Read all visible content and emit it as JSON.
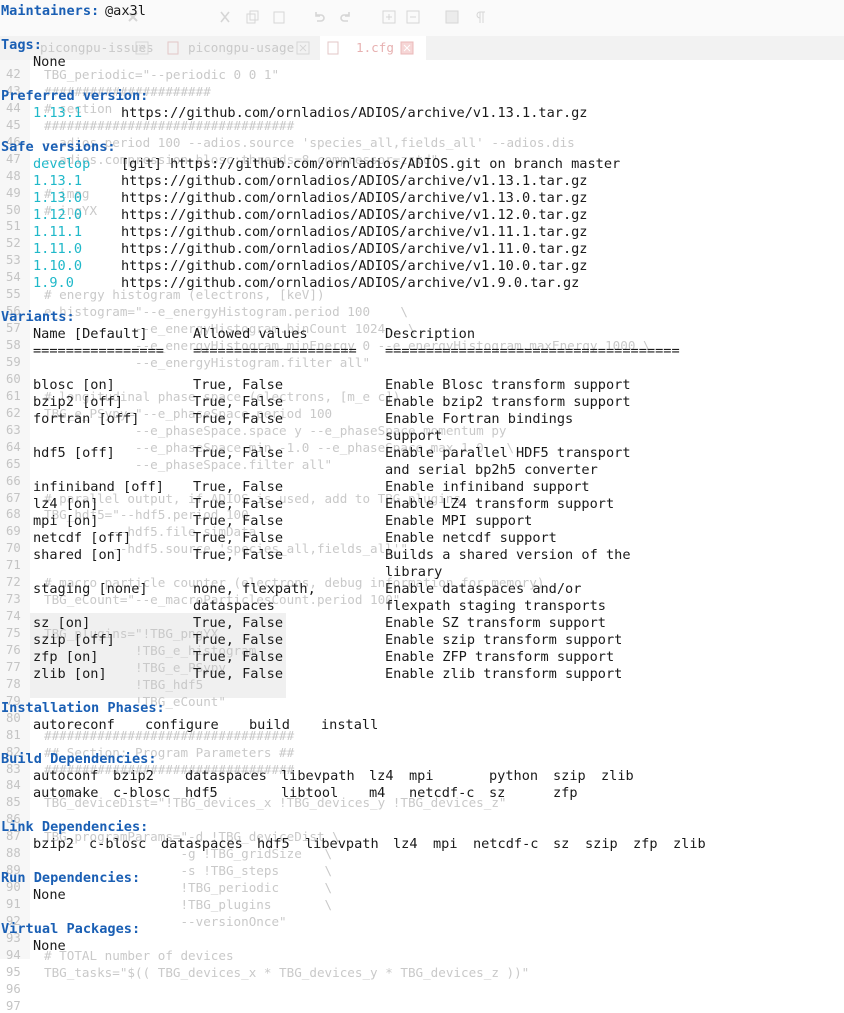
{
  "background_editor": {
    "tabs": [
      {
        "label": "picongpu-issues"
      },
      {
        "label": "picongpu-usage"
      },
      {
        "label": "1.cfg"
      }
    ],
    "gutter_numbers": [
      "42",
      "43",
      "44",
      "45",
      "46",
      "47",
      "48",
      "49",
      "50",
      "51",
      "52",
      "53",
      "54",
      "55",
      "56",
      "57",
      "58",
      "59",
      "60",
      "61",
      "62",
      "63",
      "64",
      "65",
      "66",
      "67",
      "68",
      "69",
      "70",
      "71",
      "72",
      "73",
      "74",
      "75",
      "76",
      "77",
      "78",
      "79",
      "80",
      "81",
      "82",
      "83",
      "84",
      "85",
      "86",
      "87",
      "88",
      "89",
      "90",
      "91",
      "92",
      "93",
      "94",
      "95",
      "96",
      "97"
    ],
    "lines": [
      "TBG_periodic=\"--periodic 0 0 1\"",
      "######################",
      "# section",
      "#################################",
      "--adios.period 100 --adios.source 'species_all,fields_all' --adios.dis",
      "--adios.compression blosc:threads=8,compressor=zstd\"",
      "",
      "# imag",
      "# ingYX",
      "",
      "",
      "",
      "",
      "# energy histogram (electrons, [keV])",
      "e_histogram=\"--e_energyHistogram.period 100    \\",
      "            --e_energyHistogram.binCount 1024   \\",
      "            --e_energyHistogram.minEnergy 0 --e_energyHistogram.maxEnergy 1000 \\",
      "            --e_energyHistogram.filter all\"",
      "",
      "# longitudinal phase space (electrons, [m_e c])",
      "TBG_e_PSypy=\"--e_phaseSpace.period 100",
      "            --e_phaseSpace.space y --e_phaseSpace.momentum py",
      "            --e_phaseSpace.min -1.0 --e_phaseSpace.max 1.0   \\",
      "            --e_phaseSpace.filter all\"",
      "",
      "# parallel output, if ADIOS is used, add to TBG_plugins",
      "TBG_hdf5=\"--hdf5.period 100",
      "         --hdf5.file simData",
      "         --hdf5.source 'species_all,fields_all'\"",
      "",
      "# macro particle counter (electrons, debug information for memory)",
      "TBG_eCount=\"--e_macroParticlesCount.period 100\"",
      "",
      "TBG_plugins=\"!TBG_pngYX",
      "            !TBG_e_histogram",
      "            !TBG_e_PSypy",
      "            !TBG_hdf5",
      "            !TBG_eCount\"",
      "",
      "#################################",
      "## Section: Program Parameters ##",
      "#################################",
      "",
      "TBG_deviceDist=\"!TBG_devices_x !TBG_devices_y !TBG_devices_z\"",
      "",
      "TBG_programParams=\"-d !TBG_deviceDist \\",
      "                  -g !TBG_gridSize   \\",
      "                  -s !TBG_steps      \\",
      "                  !TBG_periodic      \\",
      "                  !TBG_plugins       \\",
      "                  --versionOnce\"",
      "",
      "# TOTAL number of devices",
      "TBG_tasks=\"$(( TBG_devices_x * TBG_devices_y * TBG_devices_z ))\"",
      "",
      ""
    ]
  },
  "info": {
    "maintainers": {
      "heading": "Maintainers:",
      "value": "@ax3l"
    },
    "tags": {
      "heading": "Tags:",
      "value": "None"
    },
    "preferred_version": {
      "heading": "Preferred version:",
      "version": "1.13.1",
      "url": "https://github.com/ornladios/ADIOS/archive/v1.13.1.tar.gz"
    },
    "safe_versions": {
      "heading": "Safe versions:",
      "items": [
        {
          "version": "develop",
          "source": "[git] https://github.com/ornladios/ADIOS.git on branch master"
        },
        {
          "version": "1.13.1",
          "source": "https://github.com/ornladios/ADIOS/archive/v1.13.1.tar.gz"
        },
        {
          "version": "1.13.0",
          "source": "https://github.com/ornladios/ADIOS/archive/v1.13.0.tar.gz"
        },
        {
          "version": "1.12.0",
          "source": "https://github.com/ornladios/ADIOS/archive/v1.12.0.tar.gz"
        },
        {
          "version": "1.11.1",
          "source": "https://github.com/ornladios/ADIOS/archive/v1.11.1.tar.gz"
        },
        {
          "version": "1.11.0",
          "source": "https://github.com/ornladios/ADIOS/archive/v1.11.0.tar.gz"
        },
        {
          "version": "1.10.0",
          "source": "https://github.com/ornladios/ADIOS/archive/v1.10.0.tar.gz"
        },
        {
          "version": "1.9.0",
          "source": "https://github.com/ornladios/ADIOS/archive/v1.9.0.tar.gz"
        }
      ]
    },
    "variants": {
      "heading": "Variants:",
      "columns": {
        "name": "Name [Default]",
        "values": "Allowed values",
        "description": "Description"
      },
      "rules": {
        "name": "================",
        "values": "====================",
        "description": "===================================="
      },
      "rows": [
        {
          "name": "blosc [on]",
          "values": [
            "True, False"
          ],
          "description": [
            "Enable Blosc transform support"
          ]
        },
        {
          "name": "bzip2 [off]",
          "values": [
            "True, False"
          ],
          "description": [
            "Enable bzip2 transform support"
          ]
        },
        {
          "name": "fortran [off]",
          "values": [
            "True, False"
          ],
          "description": [
            "Enable Fortran bindings",
            "support"
          ]
        },
        {
          "name": "hdf5 [off]",
          "values": [
            "True, False"
          ],
          "description": [
            "Enable parallel HDF5 transport",
            "and serial bp2h5 converter"
          ]
        },
        {
          "name": "infiniband [off]",
          "values": [
            "True, False"
          ],
          "description": [
            "Enable infiniband support"
          ]
        },
        {
          "name": "lz4 [on]",
          "values": [
            "True, False"
          ],
          "description": [
            "Enable LZ4 transform support"
          ]
        },
        {
          "name": "mpi [on]",
          "values": [
            "True, False"
          ],
          "description": [
            "Enable MPI support"
          ]
        },
        {
          "name": "netcdf [off]",
          "values": [
            "True, False"
          ],
          "description": [
            "Enable netcdf support"
          ]
        },
        {
          "name": "shared [on]",
          "values": [
            "True, False"
          ],
          "description": [
            "Builds a shared version of the",
            "library"
          ]
        },
        {
          "name": "staging [none]",
          "values": [
            "none, flexpath,",
            "dataspaces"
          ],
          "description": [
            "Enable dataspaces and/or",
            "flexpath staging transports"
          ]
        },
        {
          "name": "sz [on]",
          "values": [
            "True, False"
          ],
          "description": [
            "Enable SZ transform support"
          ]
        },
        {
          "name": "szip [off]",
          "values": [
            "True, False"
          ],
          "description": [
            "Enable szip transform support"
          ]
        },
        {
          "name": "zfp [on]",
          "values": [
            "True, False"
          ],
          "description": [
            "Enable ZFP transform support"
          ]
        },
        {
          "name": "zlib [on]",
          "values": [
            "True, False"
          ],
          "description": [
            "Enable zlib transform support"
          ]
        }
      ]
    },
    "installation_phases": {
      "heading": "Installation Phases:",
      "items": [
        "autoreconf",
        "configure",
        "build",
        "install"
      ]
    },
    "build_dependencies": {
      "heading": "Build Dependencies:",
      "rows": [
        [
          "autoconf",
          "bzip2",
          "dataspaces",
          "libevpath",
          "lz4",
          "mpi",
          "python",
          "szip",
          "zlib"
        ],
        [
          "automake",
          "c-blosc",
          "hdf5",
          "libtool",
          "m4",
          "netcdf-c",
          "sz",
          "zfp"
        ]
      ]
    },
    "link_dependencies": {
      "heading": "Link Dependencies:",
      "items": [
        "bzip2",
        "c-blosc",
        "dataspaces",
        "hdf5",
        "libevpath",
        "lz4",
        "mpi",
        "netcdf-c",
        "sz",
        "szip",
        "zfp",
        "zlib"
      ]
    },
    "run_dependencies": {
      "heading": "Run Dependencies:",
      "value": "None"
    },
    "virtual_packages": {
      "heading": "Virtual Packages:",
      "value": "None"
    }
  }
}
